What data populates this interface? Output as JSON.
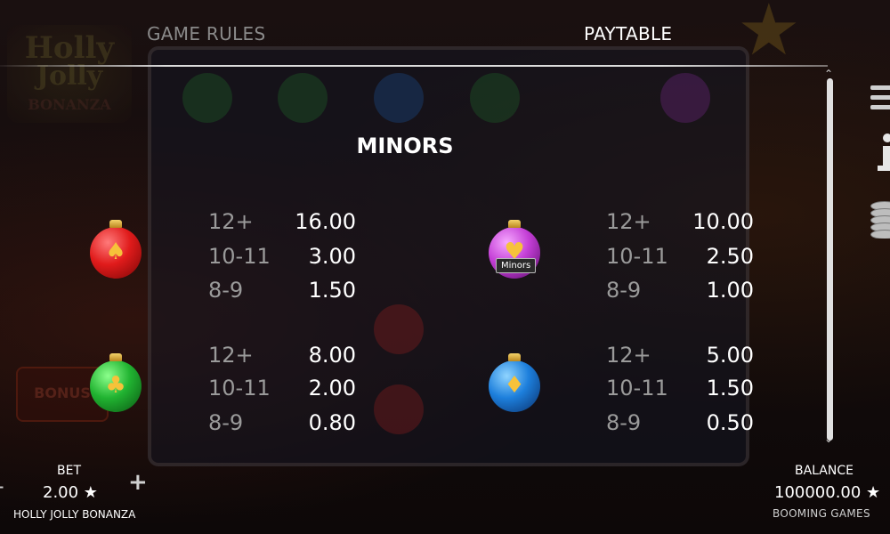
{
  "tabs": {
    "game_rules": "GAME RULES",
    "paytable": "PAYTABLE"
  },
  "section_title": "MINORS",
  "symbols": [
    {
      "id": "red",
      "glyph": "♠",
      "pays": [
        {
          "count": "12+",
          "value": "16.00"
        },
        {
          "count": "10-11",
          "value": "3.00"
        },
        {
          "count": "8-9",
          "value": "1.50"
        }
      ]
    },
    {
      "id": "purple",
      "glyph": "♥",
      "pays": [
        {
          "count": "12+",
          "value": "10.00"
        },
        {
          "count": "10-11",
          "value": "2.50"
        },
        {
          "count": "8-9",
          "value": "1.00"
        }
      ]
    },
    {
      "id": "green",
      "glyph": "♣",
      "pays": [
        {
          "count": "12+",
          "value": "8.00"
        },
        {
          "count": "10-11",
          "value": "2.00"
        },
        {
          "count": "8-9",
          "value": "0.80"
        }
      ]
    },
    {
      "id": "blue",
      "glyph": "♦",
      "pays": [
        {
          "count": "12+",
          "value": "5.00"
        },
        {
          "count": "10-11",
          "value": "1.50"
        },
        {
          "count": "8-9",
          "value": "0.50"
        }
      ]
    }
  ],
  "tooltip": "Minors",
  "bet": {
    "label": "BET",
    "value": "2.00 ★",
    "minus": "-",
    "plus": "+"
  },
  "game_name": "HOLLY JOLLY BONANZA",
  "balance": {
    "label": "BALANCE",
    "value": "100000.00 ★"
  },
  "vendor": "BOOMING GAMES",
  "background_logo": {
    "line1": "Holly",
    "line2": "Jolly",
    "line3": "BONANZA"
  },
  "background_bonus": "BONUS",
  "icons": [
    "menu-icon",
    "info-icon",
    "coins-icon"
  ],
  "colors": {
    "active_tab": "#ffffff",
    "inactive_tab": "#8a8a8a",
    "count_text": "#9a9a9a"
  }
}
